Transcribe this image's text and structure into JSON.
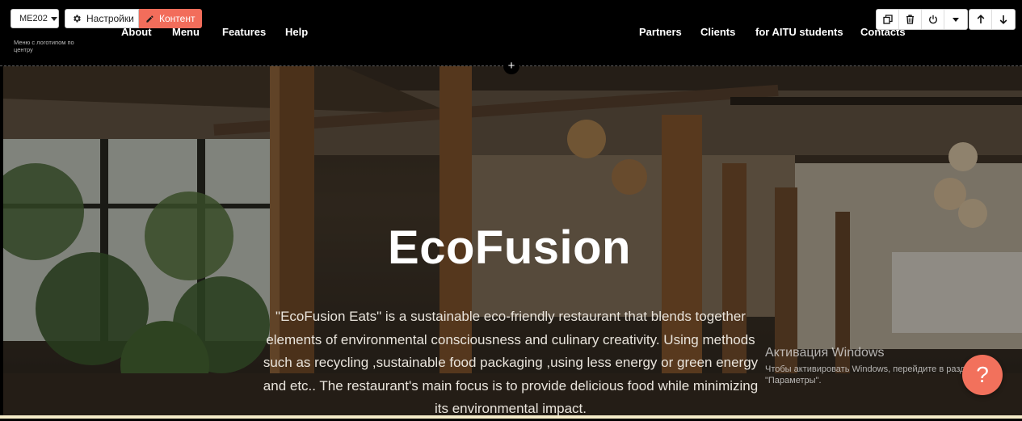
{
  "editor": {
    "block_select": "ME202",
    "settings_label": "Настройки",
    "content_label": "Контент",
    "block_description": "Меню с логотипом по центру",
    "add_block": "+"
  },
  "nav": {
    "left": [
      "About",
      "Menu",
      "Features",
      "Help"
    ],
    "right": [
      "Partners",
      "Clients",
      "for AITU students",
      "Contacts"
    ]
  },
  "hero": {
    "title": "EcoFusion",
    "description": "\"EcoFusion Eats\" is a sustainable eco-friendly restaurant that blends together elements of environmental consciousness and culinary creativity. Using methods such as recycling ,sustainable food packaging ,using less energy or green energy and etc.. The restaurant's main focus is to provide delicious food while minimizing its environmental impact."
  },
  "windows_watermark": {
    "title": "Активация Windows",
    "subtitle": "Чтобы активировать Windows, перейдите в раздел \"Параметры\"."
  },
  "help_button": "?",
  "colors": {
    "accent": "#f26d5b",
    "header_bg": "#000000",
    "help_fab": "#f2715c"
  }
}
